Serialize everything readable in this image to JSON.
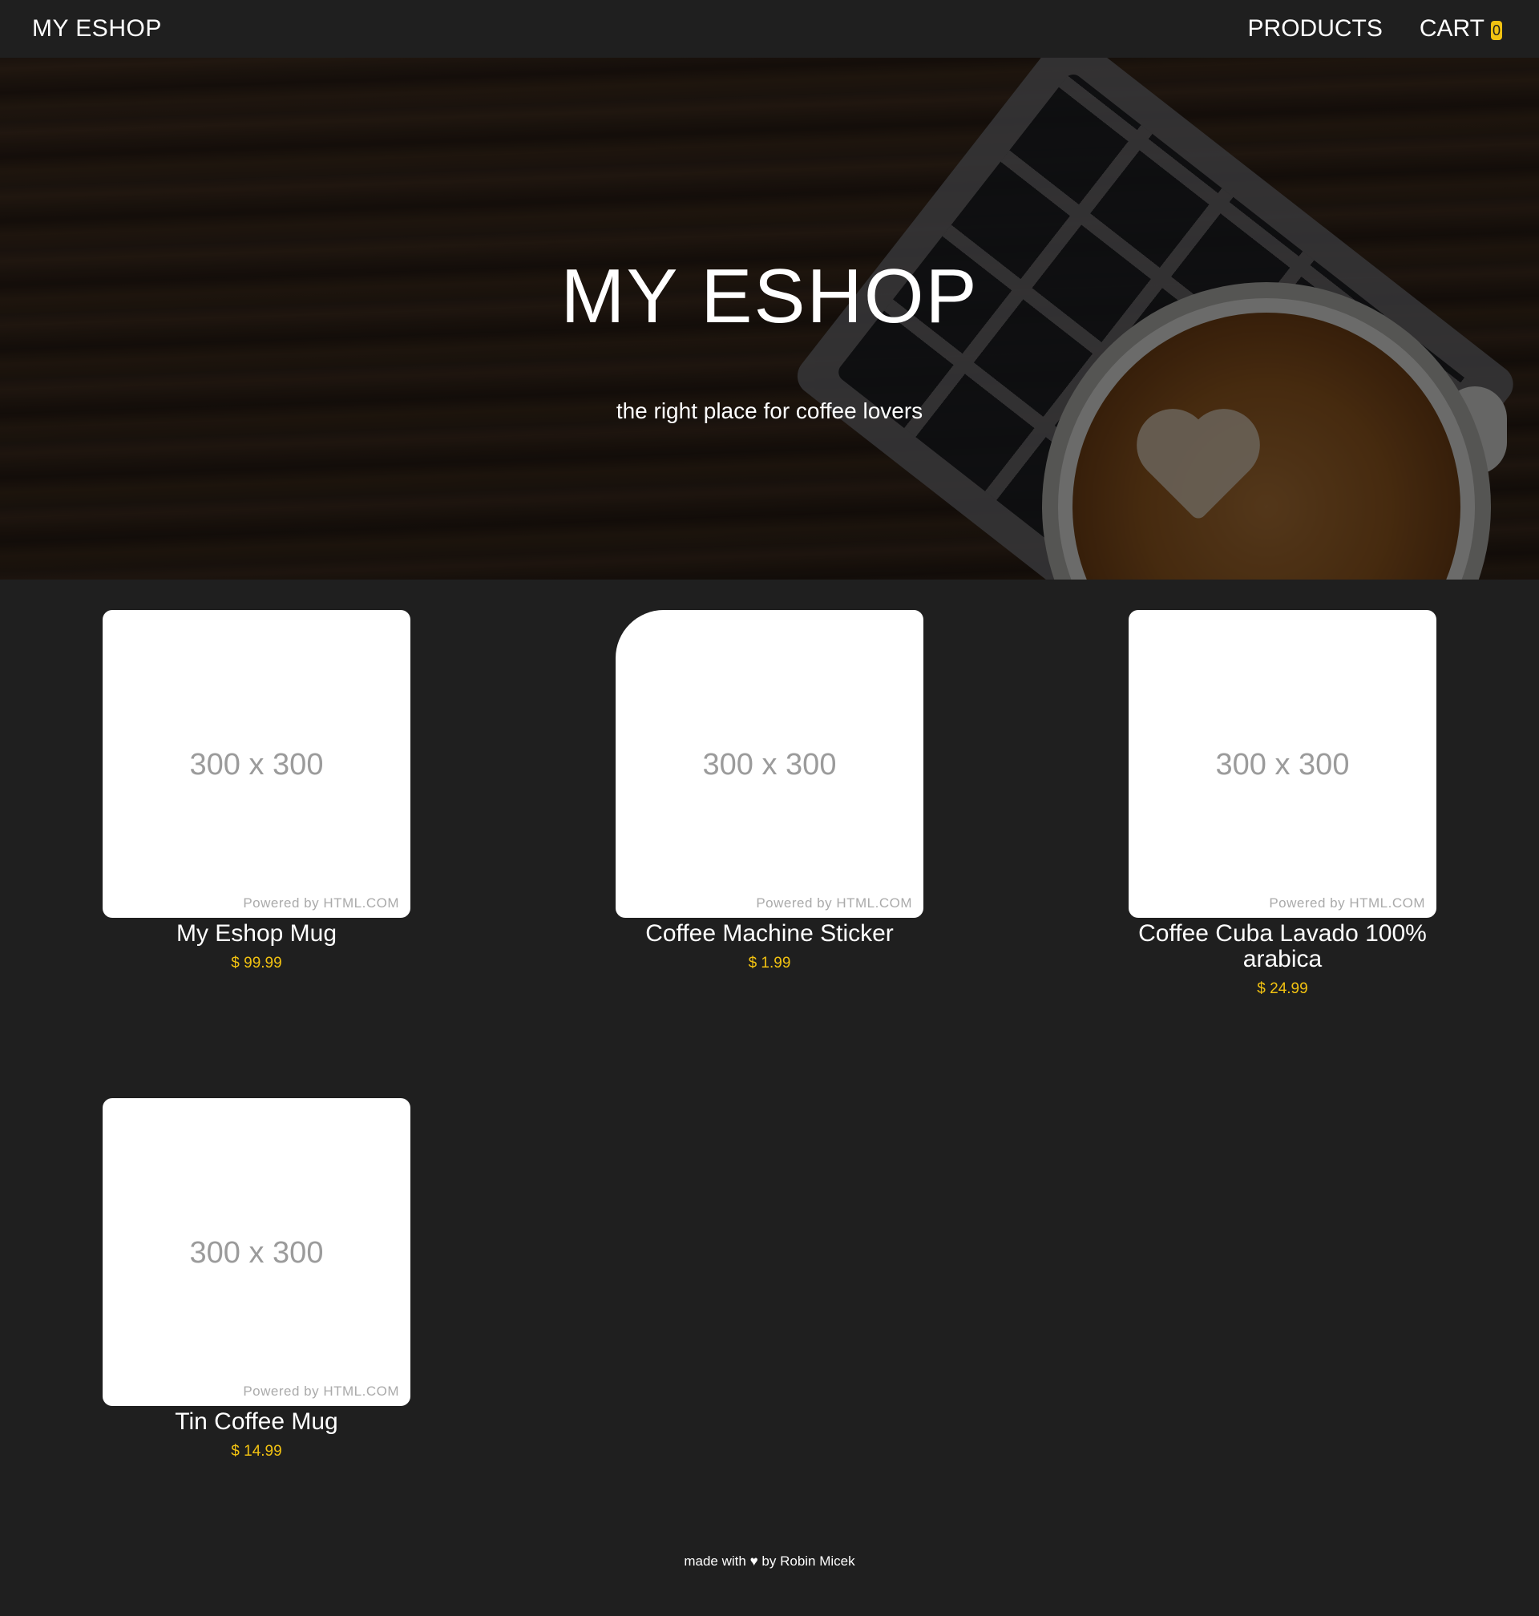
{
  "navbar": {
    "brand": "MY ESHOP",
    "links": {
      "products": "PRODUCTS",
      "cart": "CART"
    },
    "cart_count": "0"
  },
  "hero": {
    "title": "MY ESHOP",
    "subtitle": "the right place for coffee lovers"
  },
  "products": [
    {
      "placeholder": "300 x 300",
      "powered_by": "Powered by HTML.COM",
      "name": "My Eshop Mug",
      "price": "$ 99.99"
    },
    {
      "placeholder": "300 x 300",
      "powered_by": "Powered by HTML.COM",
      "name": "Coffee Machine Sticker",
      "price": "$ 1.99"
    },
    {
      "placeholder": "300 x 300",
      "powered_by": "Powered by HTML.COM",
      "name": "Coffee Cuba Lavado 100% arabica",
      "price": "$ 24.99"
    },
    {
      "placeholder": "300 x 300",
      "powered_by": "Powered by HTML.COM",
      "name": "Tin Coffee Mug",
      "price": "$ 14.99"
    }
  ],
  "footer": {
    "text_before": "made with",
    "heart_icon": "heart-icon",
    "text_after": "by Robin Micek"
  },
  "colors": {
    "background": "#1f1f1f",
    "accent": "#f2c211",
    "text": "#ffffff"
  }
}
